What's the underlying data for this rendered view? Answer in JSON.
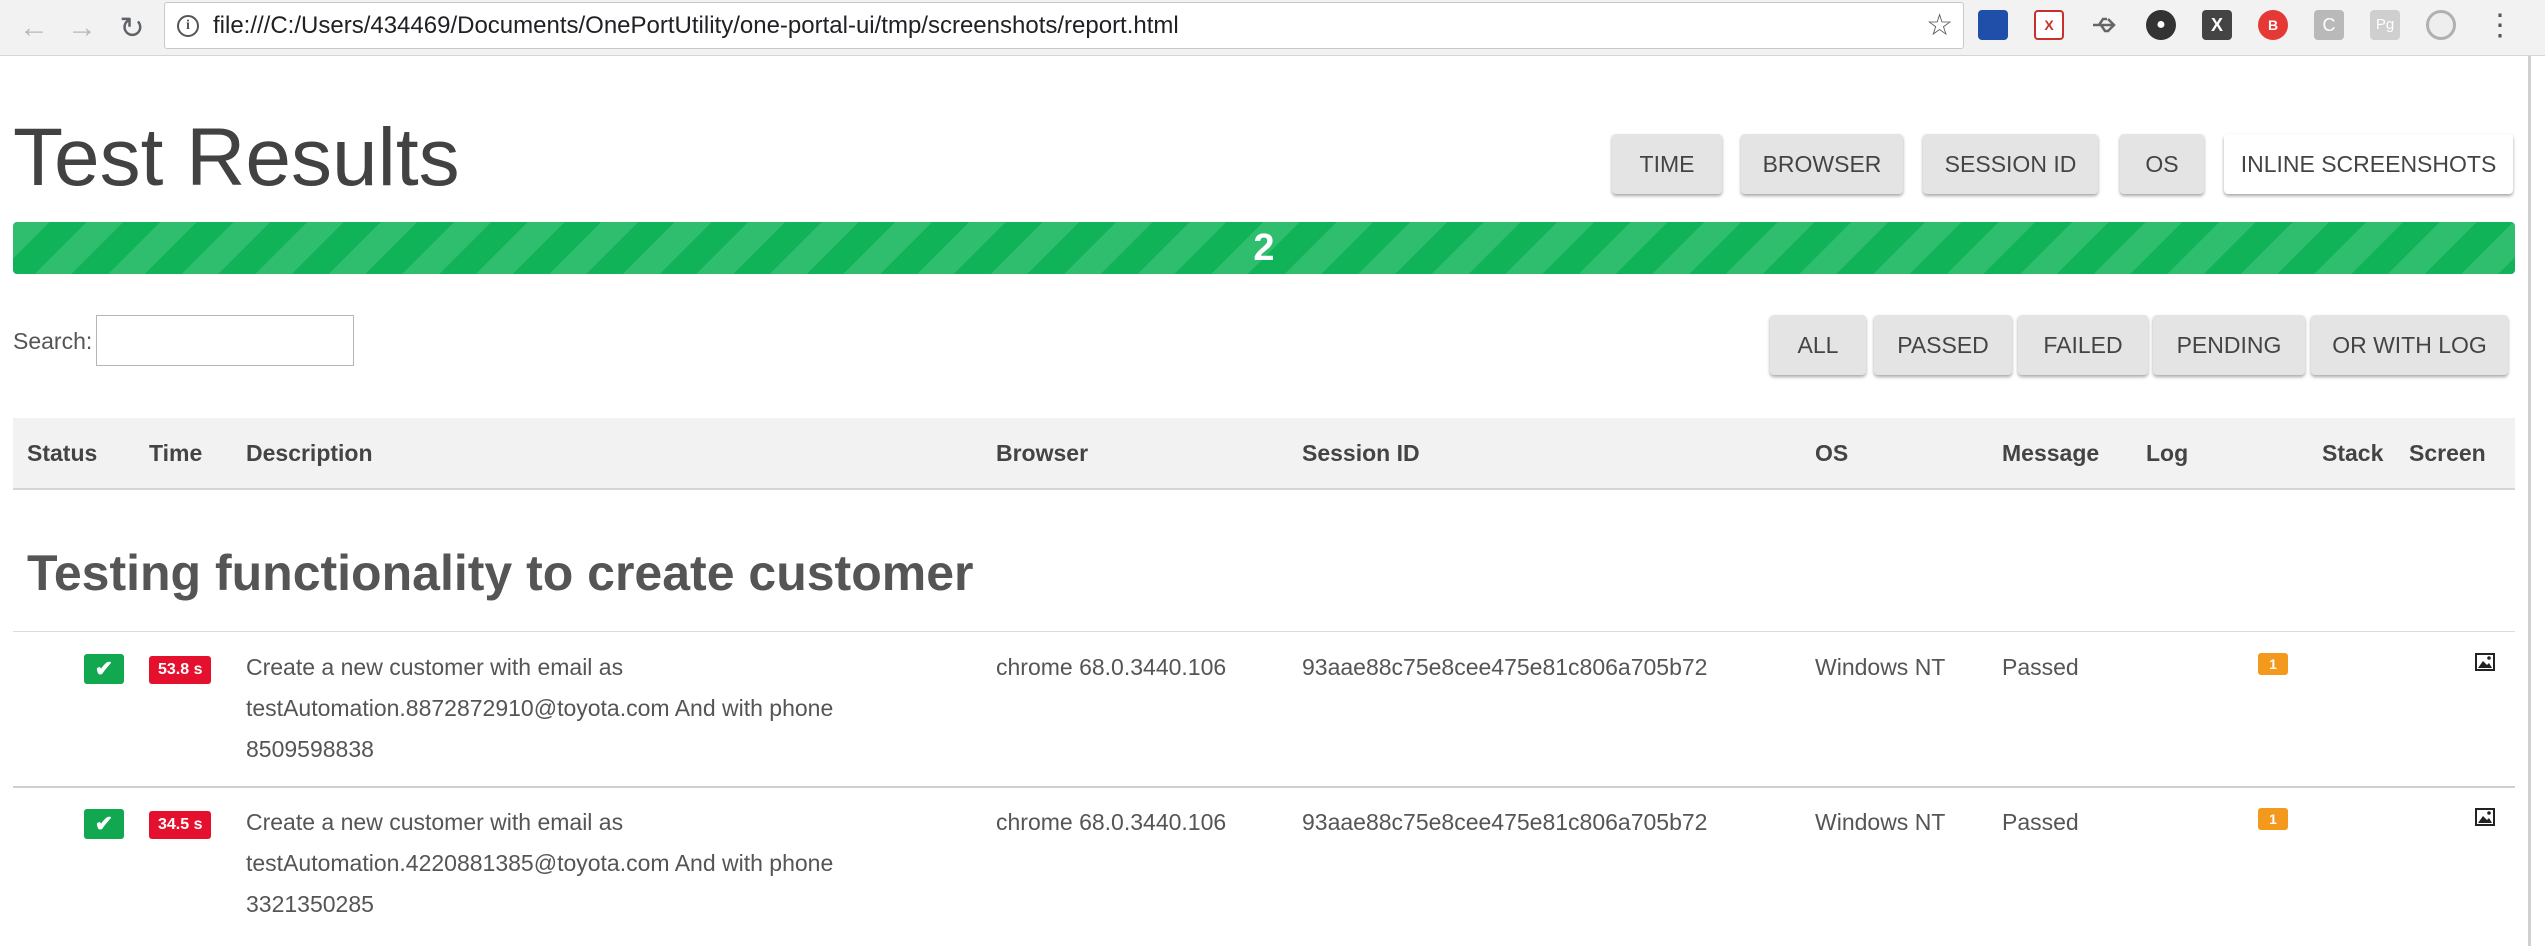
{
  "browser": {
    "url": "file:///C:/Users/434469/Documents/OnePortUtility/one-portal-ui/tmp/screenshots/report.html",
    "nav_icons": [
      "back-arrow-icon",
      "forward-arrow-icon",
      "reload-icon"
    ],
    "extension_icons": [
      "cube-extension-icon",
      "xpath-extension-icon",
      "usb-extension-icon",
      "dark-circle-extension-icon",
      "x-extension-icon",
      "red-b-extension-icon",
      "c-extension-icon",
      "pg-extension-icon",
      "dome-extension-icon"
    ]
  },
  "header": {
    "title": "Test Results",
    "toggles": [
      "TIME",
      "BROWSER",
      "SESSION ID",
      "OS",
      "INLINE SCREENSHOTS"
    ]
  },
  "progress": {
    "passed_count": "2",
    "fraction_passed": 1.0,
    "color": "#10b358"
  },
  "search": {
    "label": "Search:",
    "value": ""
  },
  "filters": [
    "ALL",
    "PASSED",
    "FAILED",
    "PENDING",
    "OR WITH LOG"
  ],
  "table": {
    "columns": {
      "status": "Status",
      "time": "Time",
      "description": "Description",
      "browser": "Browser",
      "session": "Session ID",
      "os": "OS",
      "message": "Message",
      "log": "Log",
      "stack": "Stack",
      "screen": "Screen"
    },
    "suite_title": "Testing functionality to create customer",
    "rows": [
      {
        "status": "passed",
        "time": "53.8 s",
        "desc_lines": [
          "Create a new customer with email as",
          "testAutomation.8872872910@toyota.com And with phone",
          "8509598838"
        ],
        "browser": "chrome 68.0.3440.106",
        "session": "93aae88c75e8cee475e81c806a705b72",
        "os": "Windows NT",
        "message": "Passed",
        "log_count": "1"
      },
      {
        "status": "passed",
        "time": "34.5 s",
        "desc_lines": [
          "Create a new customer with email as",
          "testAutomation.4220881385@toyota.com And with phone",
          "3321350285"
        ],
        "browser": "chrome 68.0.3440.106",
        "session": "93aae88c75e8cee475e81c806a705b72",
        "os": "Windows NT",
        "message": "Passed",
        "log_count": "1"
      }
    ]
  },
  "colors": {
    "passed": "#11a84f",
    "time_badge": "#e4102d",
    "log_badge": "#f39a1e"
  }
}
